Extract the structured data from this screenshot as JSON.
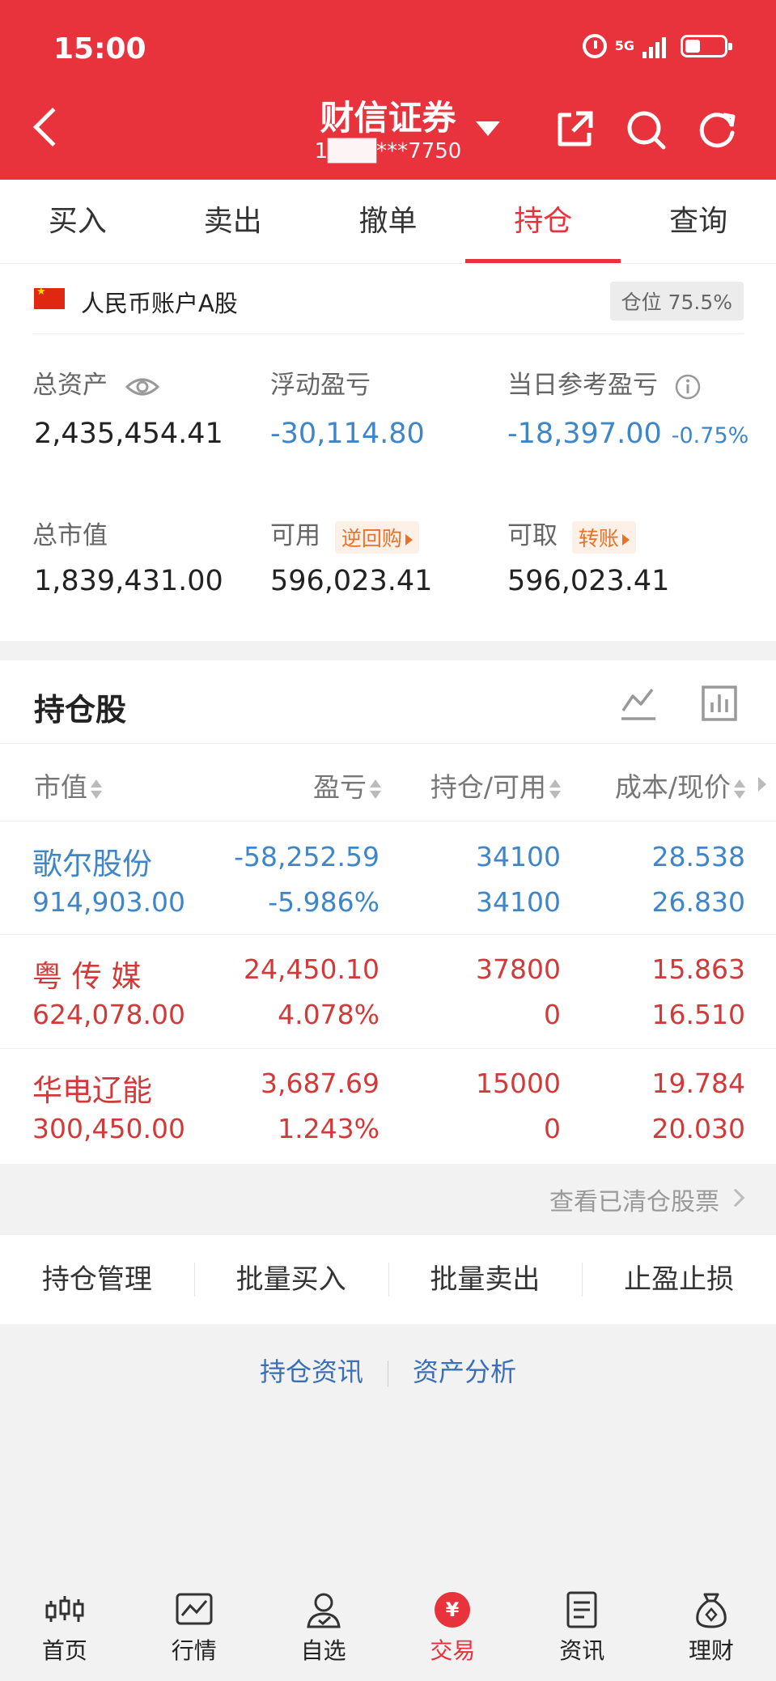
{
  "status_bar": {
    "time": "15:00",
    "network": "5G"
  },
  "header": {
    "title": "财信证券",
    "account": "1███***7750"
  },
  "tabs": [
    {
      "label": "买入"
    },
    {
      "label": "卖出"
    },
    {
      "label": "撤单"
    },
    {
      "label": "持仓",
      "active": true
    },
    {
      "label": "查询"
    }
  ],
  "account": {
    "type": "人民币账户A股",
    "position_label": "仓位 75.5%"
  },
  "summary": {
    "total_assets_label": "总资产",
    "total_assets": "2,435,454.41",
    "floating_pl_label": "浮动盈亏",
    "floating_pl": "-30,114.80",
    "daily_pl_label": "当日参考盈亏",
    "daily_pl": "-18,397.00",
    "daily_pl_pct": "-0.75%",
    "market_value_label": "总市值",
    "market_value": "1,839,431.00",
    "available_label": "可用",
    "available_pill": "逆回购",
    "available": "596,023.41",
    "withdrawable_label": "可取",
    "withdrawable_pill": "转账",
    "withdrawable": "596,023.41"
  },
  "holdings": {
    "title": "持仓股",
    "columns": [
      "市值",
      "盈亏",
      "持仓/可用",
      "成本/现价"
    ],
    "rows": [
      {
        "name": "歌尔股份",
        "market_value": "914,903.00",
        "pl": "-58,252.59",
        "pl_pct": "-5.986%",
        "position": "34100",
        "available": "34100",
        "cost": "28.538",
        "price": "26.830",
        "color": "#3f86c9"
      },
      {
        "name": "粤 传 媒",
        "market_value": "624,078.00",
        "pl": "24,450.10",
        "pl_pct": "4.078%",
        "position": "37800",
        "available": "0",
        "cost": "15.863",
        "price": "16.510",
        "color": "#d23a3a"
      },
      {
        "name": "华电辽能",
        "market_value": "300,450.00",
        "pl": "3,687.69",
        "pl_pct": "1.243%",
        "position": "15000",
        "available": "0",
        "cost": "19.784",
        "price": "20.030",
        "color": "#d23a3a"
      }
    ]
  },
  "cleared_link": "查看已清仓股票",
  "actions": [
    "持仓管理",
    "批量买入",
    "批量卖出",
    "止盈止损"
  ],
  "links": [
    "持仓资讯",
    "资产分析"
  ],
  "bottom_nav": [
    {
      "label": "首页",
      "icon": "candlestick-icon"
    },
    {
      "label": "行情",
      "icon": "chart-line-icon"
    },
    {
      "label": "自选",
      "icon": "user-check-icon"
    },
    {
      "label": "交易",
      "icon": "yuan-icon",
      "active": true
    },
    {
      "label": "资讯",
      "icon": "document-icon"
    },
    {
      "label": "理财",
      "icon": "money-bag-icon"
    }
  ]
}
